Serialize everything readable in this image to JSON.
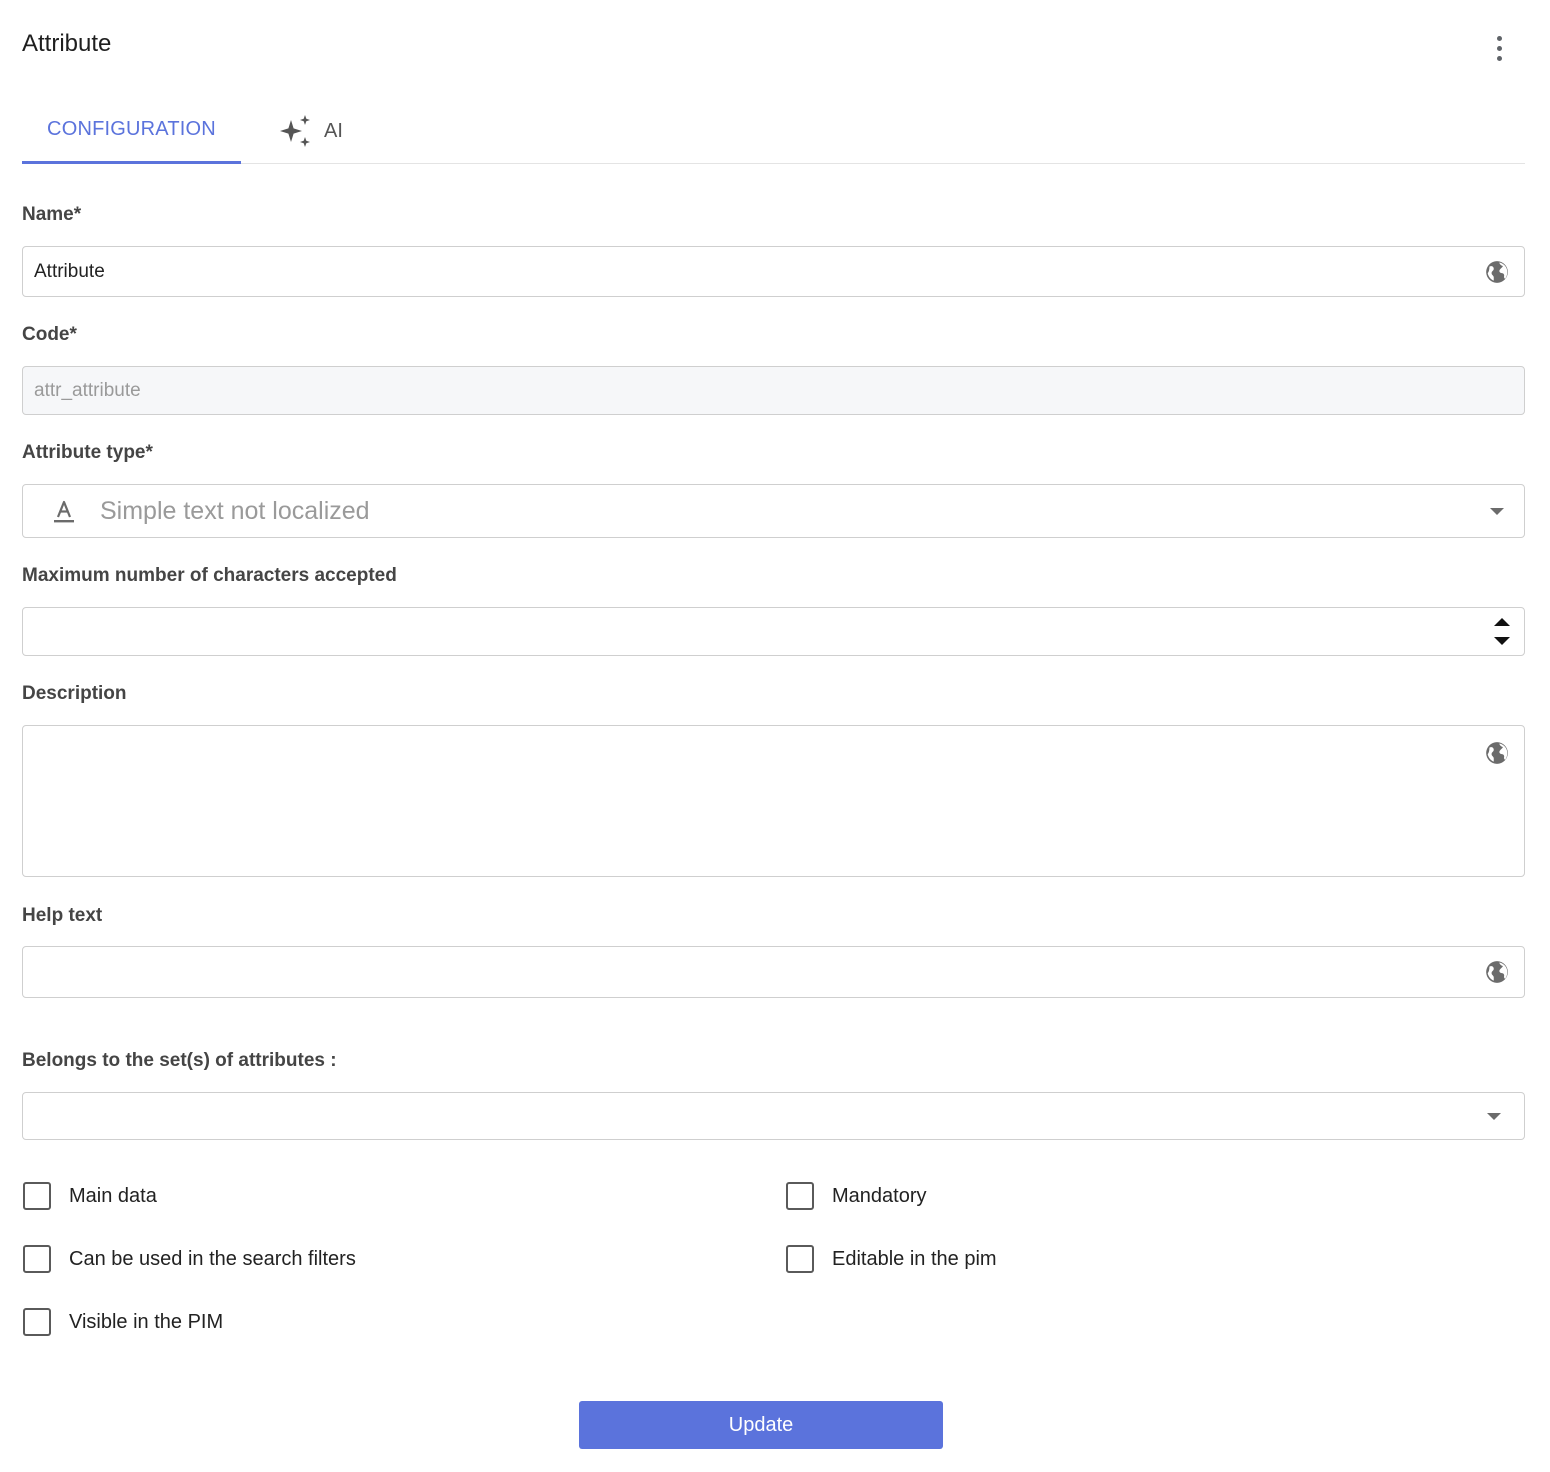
{
  "header": {
    "title": "Attribute"
  },
  "tabs": [
    {
      "label": "CONFIGURATION",
      "active": true
    },
    {
      "label": "AI",
      "icon": "sparkles-icon",
      "active": false
    }
  ],
  "form": {
    "name": {
      "label": "Name*",
      "value": "Attribute",
      "icon": "globe-icon"
    },
    "code": {
      "label": "Code*",
      "value": "attr_attribute",
      "disabled": true
    },
    "attribute_type": {
      "label": "Attribute type*",
      "value": "Simple text not localized",
      "icon": "text-format-icon"
    },
    "max_chars": {
      "label": "Maximum number of characters accepted",
      "value": ""
    },
    "description": {
      "label": "Description",
      "value": "",
      "icon": "globe-icon"
    },
    "help_text": {
      "label": "Help text",
      "value": "",
      "icon": "globe-icon"
    },
    "attribute_sets": {
      "label": "Belongs to the set(s) of attributes :",
      "value": ""
    }
  },
  "checkboxes": [
    {
      "label": "Main data",
      "checked": false
    },
    {
      "label": "Mandatory",
      "checked": false
    },
    {
      "label": "Can be used in the search filters",
      "checked": false
    },
    {
      "label": "Editable in the pim",
      "checked": false
    },
    {
      "label": "Visible in the PIM",
      "checked": false
    }
  ],
  "actions": {
    "update_label": "Update"
  },
  "colors": {
    "accent": "#5b73dc",
    "disabled_bg": "#f6f7f9",
    "border": "#cfcfcf"
  }
}
